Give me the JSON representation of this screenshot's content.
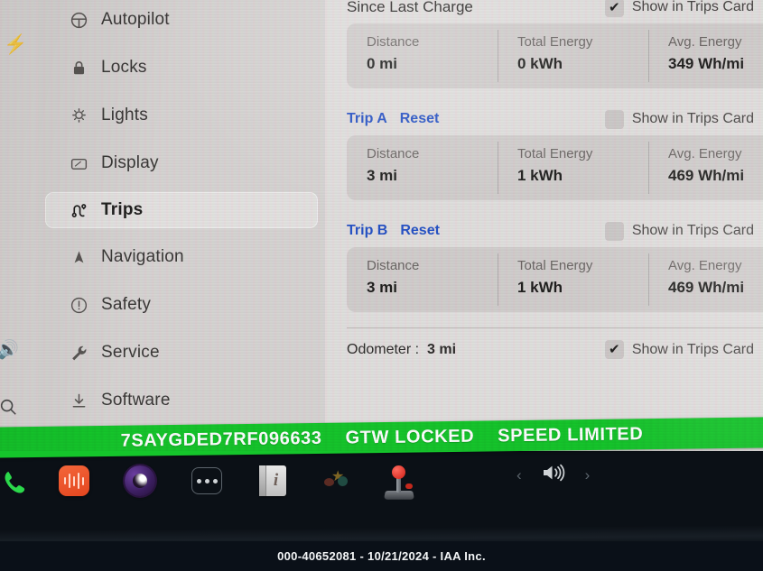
{
  "sidebar": {
    "items": [
      {
        "label": "Autopilot",
        "icon": "steering-wheel-icon",
        "active": false
      },
      {
        "label": "Locks",
        "icon": "lock-icon",
        "active": false
      },
      {
        "label": "Lights",
        "icon": "lightbulb-icon",
        "active": false
      },
      {
        "label": "Display",
        "icon": "display-icon",
        "active": false
      },
      {
        "label": "Trips",
        "icon": "trips-route-icon",
        "active": true
      },
      {
        "label": "Navigation",
        "icon": "navigation-arrow-icon",
        "active": false
      },
      {
        "label": "Safety",
        "icon": "alert-circle-icon",
        "active": false
      },
      {
        "label": "Service",
        "icon": "wrench-icon",
        "active": false
      },
      {
        "label": "Software",
        "icon": "download-icon",
        "active": false
      }
    ]
  },
  "edge_icons": {
    "charge": "lightning-bolt-icon",
    "volume": "speaker-icon",
    "search": "search-icon"
  },
  "trips": {
    "sections": [
      {
        "title": "Since Last Charge",
        "reset_label": "",
        "show_in_trips_card": "Show in Trips Card",
        "checked": true,
        "stats": [
          {
            "label": "Distance",
            "value": "0 mi"
          },
          {
            "label": "Total Energy",
            "value": "0 kWh"
          },
          {
            "label": "Avg. Energy",
            "value": "349 Wh/mi"
          }
        ]
      },
      {
        "title": "Trip A",
        "reset_label": "Reset",
        "show_in_trips_card": "Show in Trips Card",
        "checked": false,
        "stats": [
          {
            "label": "Distance",
            "value": "3 mi"
          },
          {
            "label": "Total Energy",
            "value": "1 kWh"
          },
          {
            "label": "Avg. Energy",
            "value": "469 Wh/mi"
          }
        ]
      },
      {
        "title": "Trip B",
        "reset_label": "Reset",
        "show_in_trips_card": "Show in Trips Card",
        "checked": false,
        "stats": [
          {
            "label": "Distance",
            "value": "3 mi"
          },
          {
            "label": "Total Energy",
            "value": "1 kWh"
          },
          {
            "label": "Avg. Energy",
            "value": "469 Wh/mi"
          }
        ]
      }
    ],
    "odometer": {
      "label": "Odometer :",
      "value": "3 mi",
      "show_in_trips_card": "Show in Trips Card",
      "checked": true
    }
  },
  "vin_banner": {
    "vin": "7SAYGDED7RF096633",
    "status_1": "GTW LOCKED",
    "status_2": "SPEED LIMITED",
    "background_color": "#15c52b",
    "text_color": "#ffffff"
  },
  "dock": {
    "icons": [
      {
        "name": "phone-icon",
        "label": "Phone"
      },
      {
        "name": "audio-icon",
        "label": "Media"
      },
      {
        "name": "camera-icon",
        "label": "Camera"
      },
      {
        "name": "more-icon",
        "label": "More"
      },
      {
        "name": "info-icon",
        "label": "Info"
      },
      {
        "name": "toybox-icon",
        "label": "Toybox"
      },
      {
        "name": "arcade-icon",
        "label": "Arcade"
      }
    ],
    "volume": {
      "prev": "‹",
      "speaker": "speaker-icon",
      "next": "›"
    }
  },
  "caption": {
    "text": "000-40652081 - 10/21/2024 - IAA Inc."
  }
}
